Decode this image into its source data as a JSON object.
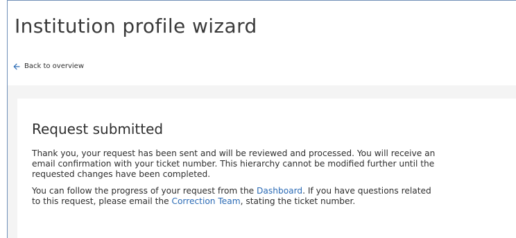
{
  "header": {
    "title": "Institution profile wizard"
  },
  "nav": {
    "back_label": "Back to overview",
    "back_icon": "arrow-left-icon"
  },
  "colors": {
    "link": "#2a6ab5",
    "background_band": "#f4f4f4",
    "frame_border": "#6f8fb7"
  },
  "card": {
    "title": "Request submitted",
    "paragraph1": {
      "lines": [
        "Thank you, your request has been sent and will be reviewed and processed. You will receive an",
        "email confirmation with your ticket number. This hierarchy cannot be modified further until the",
        "requested changes have been completed."
      ]
    },
    "paragraph2": {
      "line1_before": "You can follow the progress of your request from the ",
      "dashboard_link": "Dashboard",
      "line1_after": ". If you have questions related",
      "line2_before": "to this request, please email the ",
      "correction_link": "Correction Team",
      "line2_after": ", stating the ticket number."
    }
  }
}
